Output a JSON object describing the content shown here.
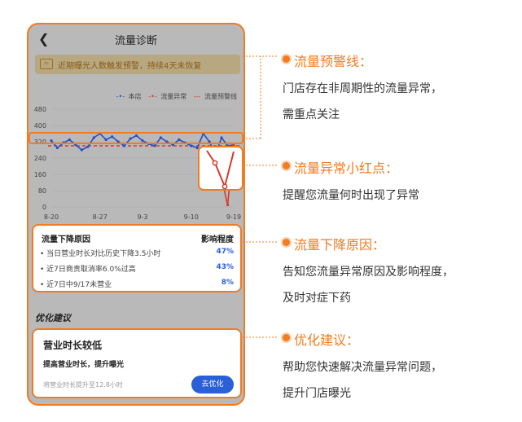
{
  "phone": {
    "back_icon": "chevron-left-icon",
    "title": "流量诊断",
    "alert": {
      "icon": "warning-card-icon",
      "text": "近期曝光人数触发预警，持续4天未恢复"
    },
    "legend": [
      {
        "label": "本店",
        "color": "#2550c8"
      },
      {
        "label": "流量异常",
        "color": "#d33b2c"
      },
      {
        "label": "流量预警线",
        "color": "#d33b2c"
      }
    ],
    "reasons": {
      "header_left": "流量下降原因",
      "header_right": "影响程度",
      "rows": [
        {
          "text": "当日营业时长对比历史下降3.5小时",
          "pct": "47%"
        },
        {
          "text": "近7日商责取消率6.0%过高",
          "pct": "43%"
        },
        {
          "text": "近7日中9/17未营业",
          "pct": "8%"
        }
      ]
    },
    "suggestion": {
      "section_title": "优化建议",
      "heading": "营业时长较低",
      "subtitle": "提高营业时长，提升曝光",
      "footnote": "将营业时长提升至12.8小时",
      "button": "去优化"
    }
  },
  "chart_data": {
    "type": "line",
    "y_ticks": [
      0,
      80,
      160,
      240,
      320,
      400,
      480
    ],
    "ylim": [
      0,
      480
    ],
    "x_ticks": [
      "8-20",
      "8-27",
      "9-3",
      "9-10",
      "9-19"
    ],
    "x_count": 31,
    "warning_line": 300,
    "series": [
      {
        "name": "本店",
        "color": "#2550c8",
        "values": [
          325,
          290,
          315,
          330,
          305,
          280,
          295,
          340,
          360,
          330,
          345,
          320,
          300,
          335,
          350,
          325,
          310,
          300,
          340,
          320,
          305,
          330,
          315,
          300,
          290,
          360,
          320,
          260,
          340,
          300,
          305
        ]
      },
      {
        "name": "流量异常",
        "color": "#d33b2c",
        "values": [
          null,
          null,
          null,
          null,
          null,
          null,
          null,
          null,
          null,
          null,
          null,
          null,
          null,
          null,
          null,
          null,
          null,
          null,
          null,
          null,
          null,
          null,
          null,
          null,
          null,
          null,
          null,
          260,
          140,
          10,
          305
        ]
      }
    ]
  },
  "annotations": [
    {
      "title": "流量预警线：",
      "lines": [
        "门店存在非周期性的流量异常，",
        "需重点关注"
      ]
    },
    {
      "title": "流量异常小红点：",
      "lines": [
        "提醒您流量何时出现了异常"
      ]
    },
    {
      "title": "流量下降原因：",
      "lines": [
        "告知您流量异常原因及影响程度，",
        "及时对症下药"
      ]
    },
    {
      "title": "优化建议：",
      "lines": [
        "帮助您快速解决流量异常问题，",
        "提升门店曝光"
      ]
    }
  ]
}
